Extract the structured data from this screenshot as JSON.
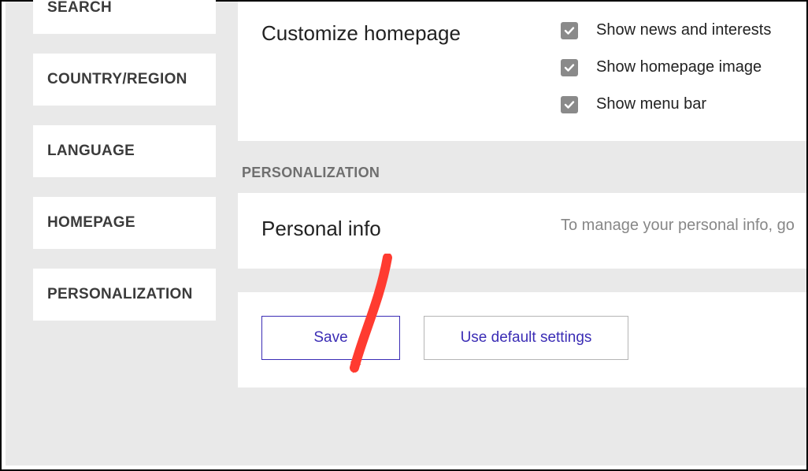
{
  "sidebar": {
    "items": [
      {
        "label": "SEARCH"
      },
      {
        "label": "COUNTRY/REGION"
      },
      {
        "label": "LANGUAGE"
      },
      {
        "label": "HOMEPAGE"
      },
      {
        "label": "PERSONALIZATION"
      }
    ]
  },
  "homepage": {
    "title": "Customize homepage",
    "options": [
      {
        "label": "Show news and interests",
        "checked": true
      },
      {
        "label": "Show homepage image",
        "checked": true
      },
      {
        "label": "Show menu bar",
        "checked": true
      }
    ]
  },
  "personalization": {
    "header": "PERSONALIZATION",
    "title": "Personal info",
    "description": "To manage your personal info, go"
  },
  "buttons": {
    "save": "Save",
    "default": "Use default settings"
  }
}
